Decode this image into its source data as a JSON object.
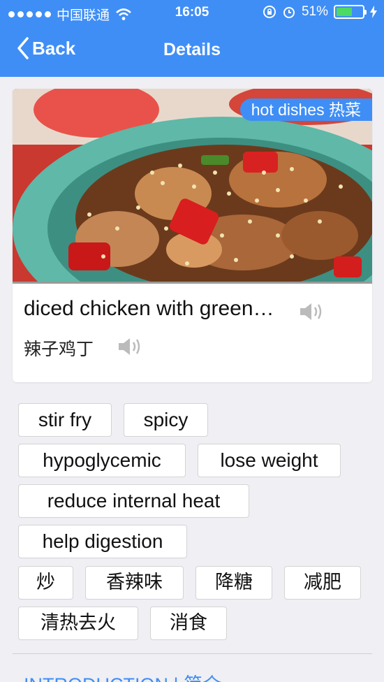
{
  "status_bar": {
    "carrier": "中国联通",
    "time": "16:05",
    "battery_percent": "51%",
    "battery_level": 0.51,
    "signal_bars": 5
  },
  "nav": {
    "back_label": "Back",
    "title": "Details"
  },
  "dish": {
    "category": "hot dishes 热菜",
    "name_en": "diced chicken with green…",
    "name_zh": "辣子鸡丁"
  },
  "tags": [
    "stir fry",
    "spicy",
    "hypoglycemic",
    "lose weight",
    "reduce internal heat",
    "help digestion",
    "炒",
    "香辣味",
    "降糖",
    "减肥",
    "清热去火",
    "消食"
  ],
  "section": {
    "intro_label": "INTRODUCTION | 简介"
  },
  "colors": {
    "accent": "#3f8ef6",
    "battery": "#4cd964"
  },
  "icons": [
    "back-chevron-icon",
    "wifi-icon",
    "rotation-lock-icon",
    "alarm-icon",
    "battery-icon",
    "speaker-icon"
  ]
}
